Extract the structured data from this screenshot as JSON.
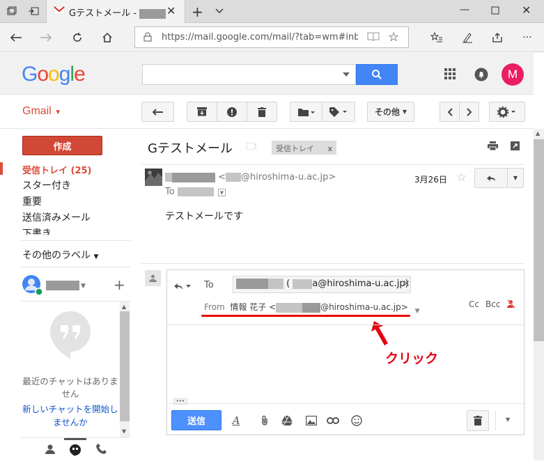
{
  "browser": {
    "tab_title": "Gテストメール -",
    "url": "https://mail.google.com/mail/?tab=wm#inbox/16"
  },
  "header": {
    "logo": "Google",
    "avatar_letter": "M",
    "colors": {
      "avatar": "#e91e63",
      "search_button": "#4285f4"
    }
  },
  "toolbar": {
    "gmail_label": "Gmail",
    "more_label": "その他"
  },
  "sidebar": {
    "compose_label": "作成",
    "items": [
      {
        "label": "受信トレイ (25)"
      },
      {
        "label": "スター付き"
      },
      {
        "label": "重要"
      },
      {
        "label": "送信済みメール"
      },
      {
        "label": "下書き"
      }
    ],
    "other_labels": "その他のラベル"
  },
  "chat": {
    "empty_text": "最近のチャットはありません",
    "start_link": "新しいチャットを開始しませんか"
  },
  "message": {
    "subject": "Gテストメール",
    "label_chip": "受信トレイ",
    "label_chip_close": "x",
    "sender_email_suffix": "@hiroshima-u.ac.jp>",
    "sender_email_prefix": "<",
    "to_label": "To",
    "date": "3月26日",
    "body": "テストメールです"
  },
  "reply": {
    "to_label": "To",
    "recipient_paren": "(",
    "recipient_email": "a@hiroshima-u.ac.jp)",
    "recipient_remove": "×",
    "from_label": "From",
    "from_name": "情報 花子 <",
    "from_email": "@hiroshima-u.ac.jp>",
    "cc_label": "Cc",
    "bcc_label": "Bcc",
    "ellipsis": "•••",
    "send_label": "送信"
  },
  "annotation": {
    "click_text": "クリック",
    "color": "#e60012"
  }
}
